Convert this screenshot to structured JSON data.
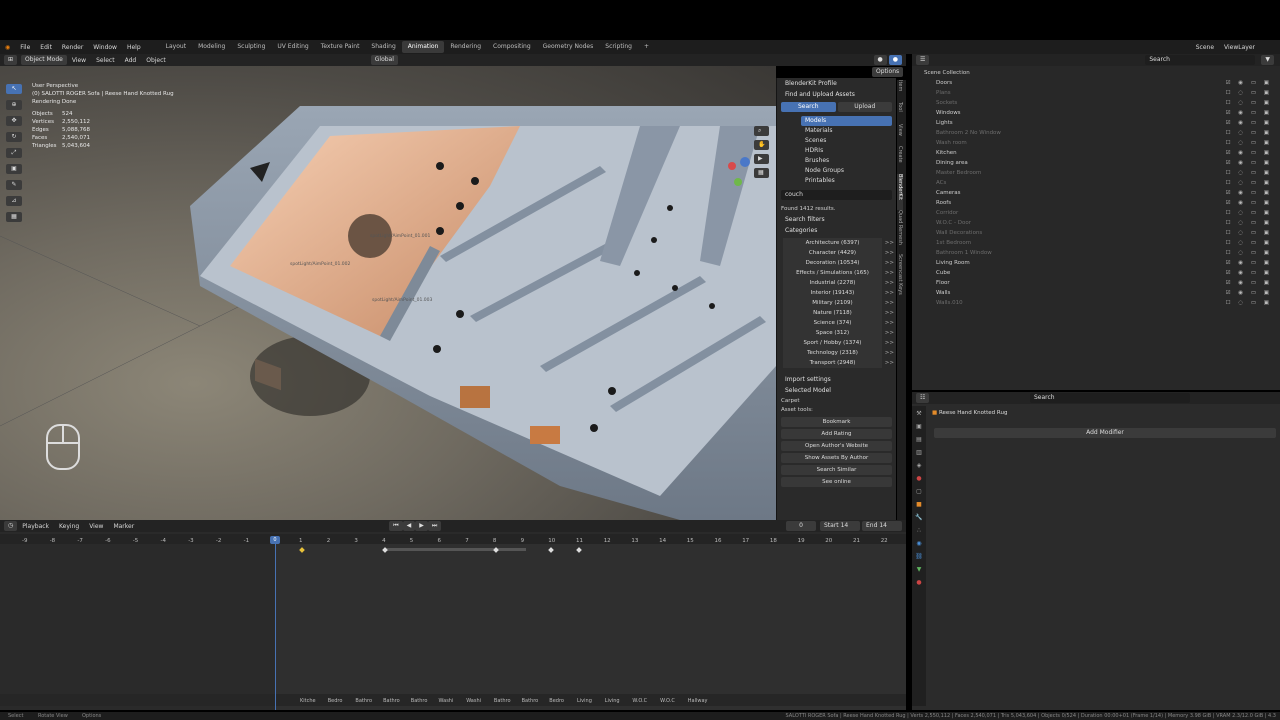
{
  "menu": {
    "items": [
      "File",
      "Edit",
      "Render",
      "Window",
      "Help"
    ],
    "workspaces": [
      "Layout",
      "Modeling",
      "Sculpting",
      "UV Editing",
      "Texture Paint",
      "Shading",
      "Animation",
      "Rendering",
      "Compositing",
      "Geometry Nodes",
      "Scripting"
    ],
    "active_workspace": "Animation",
    "scene_label": "Scene",
    "view_layer_label": "ViewLayer"
  },
  "viewport_header": {
    "mode": "Object Mode",
    "menus": [
      "View",
      "Select",
      "Add",
      "Object"
    ],
    "transform": "Global",
    "search_value": "couch",
    "options_label": "Options"
  },
  "viewport_overlay": {
    "perspective": "User Perspective",
    "object_name": "(0) SALOTTI ROGER Sofa | Reese Hand Knotted Rug",
    "render_status": "Rendering Done",
    "stats": [
      {
        "label": "Objects",
        "value": "524"
      },
      {
        "label": "Vertices",
        "value": "2,550,112"
      },
      {
        "label": "Edges",
        "value": "5,088,768"
      },
      {
        "label": "Faces",
        "value": "2,540,071"
      },
      {
        "label": "Triangles",
        "value": "5,043,604"
      }
    ],
    "spot_labels": [
      "spotLight/AimPoint_01.001",
      "spotLight/AimPoint_01.002",
      "spotLight/AimPoint_01.003"
    ]
  },
  "blenderkit": {
    "profile": "BlenderKit Profile",
    "find_upload": "Find and Upload Assets",
    "search_tab": "Search",
    "upload_tab": "Upload",
    "asset_types": [
      "Models",
      "Materials",
      "Scenes",
      "HDRIs",
      "Brushes",
      "Node Groups",
      "Printables"
    ],
    "active_type": "Models",
    "search_value": "couch",
    "results": "Found 1412 results.",
    "search_filters": "Search filters",
    "categories_label": "Categories",
    "categories": [
      "Architecture (6397)",
      "Character (4429)",
      "Decoration (10534)",
      "Effects / Simulations (165)",
      "Industrial (2278)",
      "Interior (19143)",
      "Military (2109)",
      "Nature (7118)",
      "Science (374)",
      "Space (312)",
      "Sport / Hobby (1374)",
      "Technology (2318)",
      "Transport (2948)"
    ],
    "import_settings": "Import settings",
    "selected_model": "Selected Model",
    "selected_name": "Carpet",
    "asset_tools": "Asset tools:",
    "tool_buttons": [
      "Bookmark",
      "Add Rating",
      "Open Author's Website",
      "Show Assets By Author",
      "Search Similar",
      "See online"
    ]
  },
  "side_tabs": [
    "Item",
    "Tool",
    "View",
    "Create",
    "BlenderKit",
    "Quad Remesh",
    "Screencast Keys"
  ],
  "outliner": {
    "search_placeholder": "Search",
    "root": "Scene Collection",
    "items": [
      {
        "name": "Doors",
        "dim": false
      },
      {
        "name": "Plans",
        "dim": true
      },
      {
        "name": "Sockets",
        "dim": true
      },
      {
        "name": "Windows",
        "dim": false
      },
      {
        "name": "Lights",
        "dim": false
      },
      {
        "name": "Bathroom 2 No Window",
        "dim": true
      },
      {
        "name": "Wash room",
        "dim": true
      },
      {
        "name": "Kitchen",
        "dim": false
      },
      {
        "name": "Dining area",
        "dim": false
      },
      {
        "name": "Master Bedroom",
        "dim": true
      },
      {
        "name": "ACs",
        "dim": true
      },
      {
        "name": "Cameras",
        "dim": false
      },
      {
        "name": "Roofs",
        "dim": false
      },
      {
        "name": "Corridor",
        "dim": true
      },
      {
        "name": "W.O.C - Door",
        "dim": true
      },
      {
        "name": "Wall Decorations",
        "dim": true
      },
      {
        "name": "1st Bedroom",
        "dim": true
      },
      {
        "name": "Bathroom 1 Window",
        "dim": true
      },
      {
        "name": "Living Room",
        "dim": false
      },
      {
        "name": "Cube",
        "dim": false
      },
      {
        "name": "Floor",
        "dim": false
      },
      {
        "name": "Walls",
        "dim": false
      },
      {
        "name": "Walls.010",
        "dim": true
      }
    ]
  },
  "properties": {
    "search_placeholder": "Search",
    "object_name": "Reese Hand Knotted Rug",
    "add_modifier": "Add Modifier"
  },
  "timeline": {
    "menus": [
      "Playback",
      "Keying",
      "View",
      "Marker"
    ],
    "current_frame": "0",
    "start_label": "Start",
    "start_value": "14",
    "end_label": "End",
    "end_value": "14",
    "ticks": [
      "-9",
      "-8",
      "-7",
      "-6",
      "-5",
      "-4",
      "-3",
      "-2",
      "-1",
      "0",
      "1",
      "2",
      "3",
      "4",
      "5",
      "6",
      "7",
      "8",
      "9",
      "10",
      "11",
      "12",
      "13",
      "14",
      "15",
      "16",
      "17",
      "18",
      "19",
      "20",
      "21",
      "22"
    ],
    "markers": [
      "Kitche",
      "Bedro",
      "Bathro",
      "Bathro",
      "Bathro",
      "Washi",
      "Washi",
      "Bathro",
      "Bathro",
      "Bedro",
      "Living",
      "Living",
      "W.O.C",
      "W.O.C",
      "Hallway"
    ]
  },
  "status_bar": {
    "left": [
      "Select",
      "Rotate View",
      "Options"
    ],
    "right": "SALOTTI ROGER Sofa | Reese Hand Knotted Rug | Verts 2,550,112 | Faces 2,540,071 | Tris 5,043,604 | Objects 0/524 | Duration 00:00+01 (Frame 1/14) | Memory 3.98 GiB | VRAM 2.3/12.0 GiB | 4.3"
  },
  "colors": {
    "accent": "#4772b3",
    "orange": "#e38b2a",
    "green": "#5fb55f"
  }
}
